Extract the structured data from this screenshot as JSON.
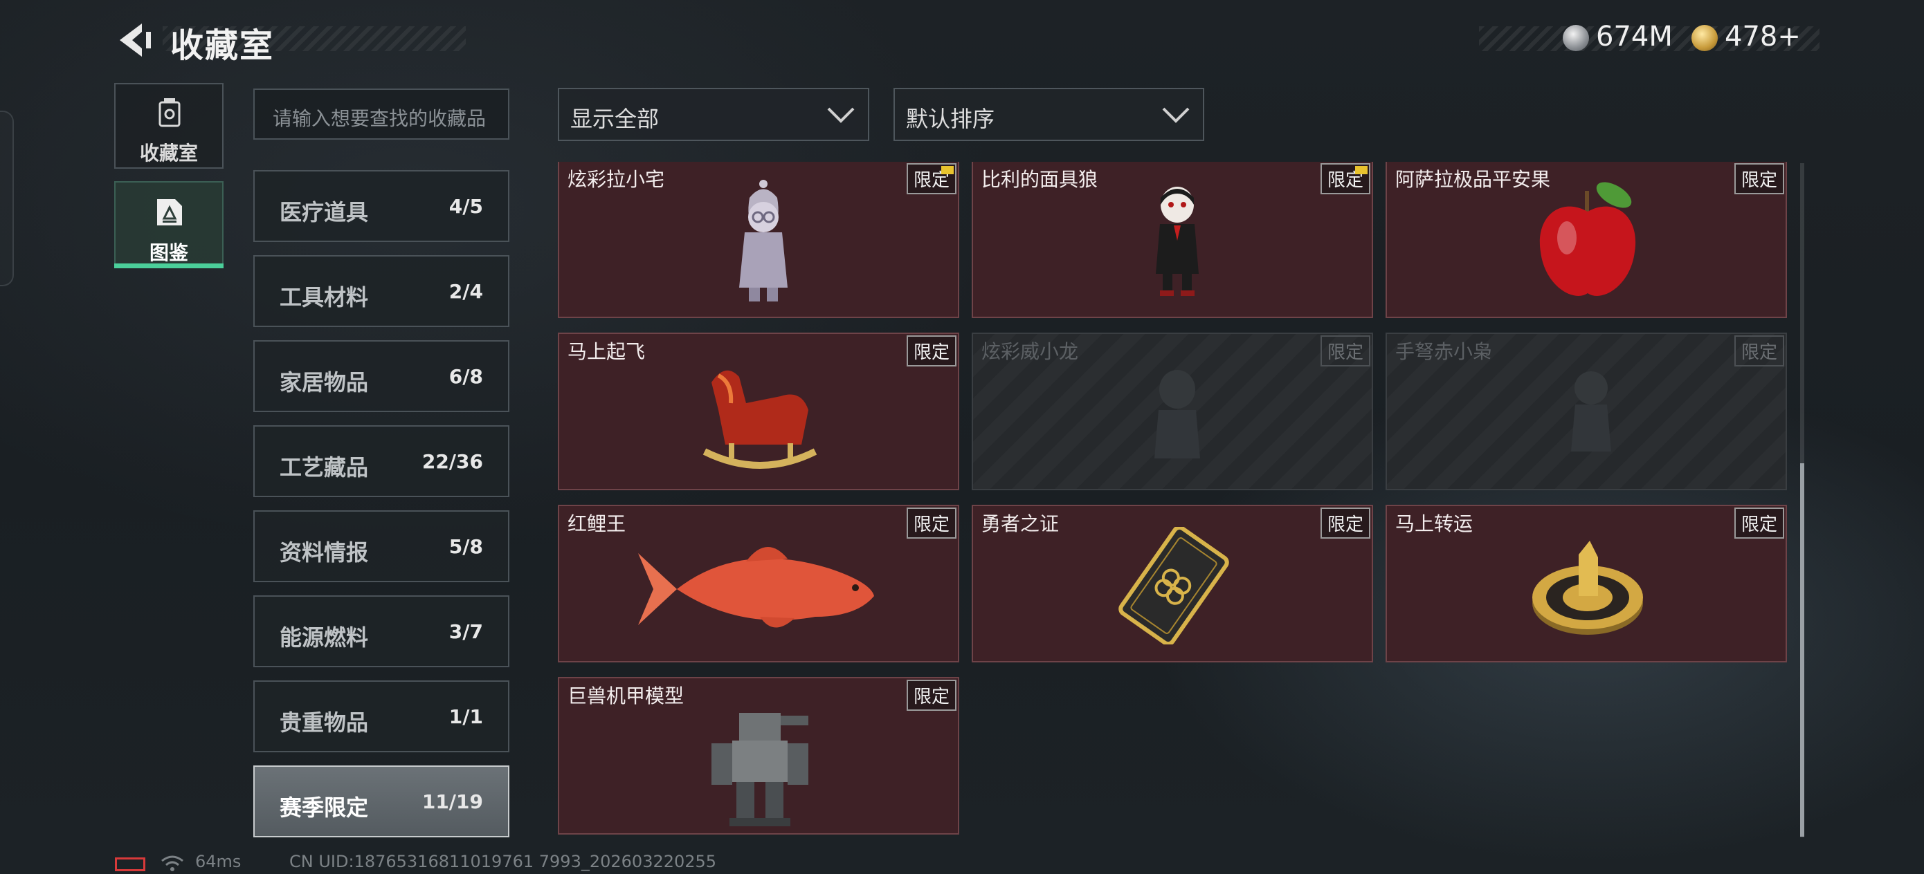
{
  "header": {
    "back_icon": "chevron-left-icon",
    "title": "收藏室",
    "currencies": [
      {
        "name": "silver-coin-icon",
        "amount": "674M"
      },
      {
        "name": "gold-coin-icon",
        "amount": "478+"
      }
    ]
  },
  "side_tabs": [
    {
      "label": "收藏室",
      "icon": "trash-can-icon",
      "active": false
    },
    {
      "label": "图鉴",
      "icon": "codex-icon",
      "active": true
    }
  ],
  "search": {
    "placeholder": "请输入想要查找的收藏品"
  },
  "filters": {
    "filter_value": "显示全部",
    "sort_value": "默认排序"
  },
  "categories": [
    {
      "name": "医疗道具",
      "count": "4/5"
    },
    {
      "name": "工具材料",
      "count": "2/4"
    },
    {
      "name": "家居物品",
      "count": "6/8"
    },
    {
      "name": "工艺藏品",
      "count": "22/36"
    },
    {
      "name": "资料情报",
      "count": "5/8"
    },
    {
      "name": "能源燃料",
      "count": "3/7"
    },
    {
      "name": "贵重物品",
      "count": "1/1"
    },
    {
      "name": "赛季限定",
      "count": "11/19",
      "active": true
    }
  ],
  "items": [
    {
      "name": "炫彩拉小宅",
      "badge": "限定",
      "owned": true,
      "new": true,
      "icon": "hooded-figurine-icon"
    },
    {
      "name": "比利的面具狼",
      "badge": "限定",
      "owned": true,
      "new": true,
      "icon": "puppet-doll-icon"
    },
    {
      "name": "阿萨拉极品平安果",
      "badge": "限定",
      "owned": true,
      "new": false,
      "icon": "red-apple-icon"
    },
    {
      "name": "马上起飞",
      "badge": "限定",
      "owned": true,
      "new": false,
      "icon": "rocking-horse-icon"
    },
    {
      "name": "炫彩威小龙",
      "badge": "限定",
      "owned": false,
      "new": false,
      "icon": "dragon-figurine-icon"
    },
    {
      "name": "手弩赤小枭",
      "badge": "限定",
      "owned": false,
      "new": false,
      "icon": "owl-figurine-icon"
    },
    {
      "name": "红鲤王",
      "badge": "限定",
      "owned": true,
      "new": false,
      "icon": "red-carp-icon"
    },
    {
      "name": "勇者之证",
      "badge": "限定",
      "owned": true,
      "new": false,
      "icon": "gold-card-icon"
    },
    {
      "name": "马上转运",
      "badge": "限定",
      "owned": true,
      "new": false,
      "icon": "gold-medallion-icon"
    },
    {
      "name": "巨兽机甲模型",
      "badge": "限定",
      "owned": true,
      "new": false,
      "icon": "mech-model-icon"
    }
  ],
  "footer": {
    "ping": "64ms",
    "uid": "CN UID:18765316811019761 7993_202603220255"
  },
  "colors": {
    "card_owned": "#3e2126",
    "card_locked": "#26292c",
    "active_tab_accent": "#4bcf9a"
  }
}
